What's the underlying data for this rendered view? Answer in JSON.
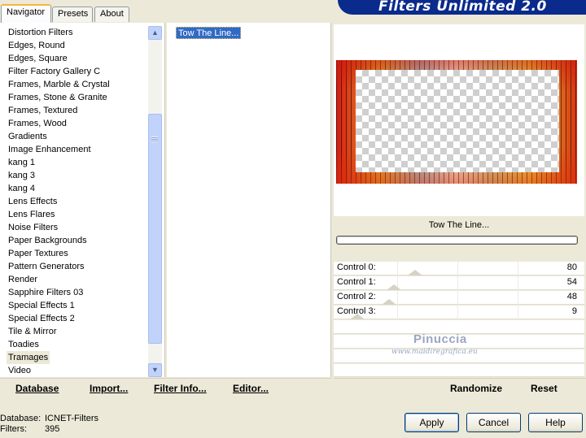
{
  "tabs": [
    {
      "label": "Navigator",
      "active": true
    },
    {
      "label": "Presets",
      "active": false
    },
    {
      "label": "About",
      "active": false
    }
  ],
  "banner_title": "Filters Unlimited 2.0",
  "categories": [
    "Distortion Filters",
    "Edges, Round",
    "Edges, Square",
    "Filter Factory Gallery C",
    "Frames, Marble & Crystal",
    "Frames, Stone & Granite",
    "Frames, Textured",
    "Frames, Wood",
    "Gradients",
    "Image Enhancement",
    "kang 1",
    "kang 3",
    "kang 4",
    "Lens Effects",
    "Lens Flares",
    "Noise Filters",
    "Paper Backgrounds",
    "Paper Textures",
    "Pattern Generators",
    "Render",
    "Sapphire Filters 03",
    "Special Effects 1",
    "Special Effects 2",
    "Tile & Mirror",
    "Toadies",
    "Tramages",
    "Video"
  ],
  "selected_category": "Tramages",
  "filters": [
    "Tow The Line..."
  ],
  "preview": {
    "filter_name": "Tow The Line..."
  },
  "controls": [
    {
      "label": "Control 0:",
      "value": "80",
      "level": 0.31
    },
    {
      "label": "Control 1:",
      "value": "54",
      "level": 0.21
    },
    {
      "label": "Control 2:",
      "value": "48",
      "level": 0.19
    },
    {
      "label": "Control 3:",
      "value": "9",
      "level": 0.04
    }
  ],
  "watermark": {
    "name": "Pinuccia",
    "url": "www.maidiregrafica.eu"
  },
  "left_toolbar": {
    "database": "Database",
    "import": "Import...",
    "filter_info": "Filter Info...",
    "editor": "Editor..."
  },
  "right_toolbar": {
    "randomize": "Randomize",
    "reset": "Reset"
  },
  "status": {
    "database_label": "Database:",
    "database_value": "ICNET-Filters",
    "filters_label": "Filters:",
    "filters_value": "395"
  },
  "buttons": {
    "apply": "Apply",
    "cancel": "Cancel",
    "help": "Help"
  },
  "colors": {
    "selection": "#316ac5",
    "banner": "#0a2a8c",
    "face": "#ece9d8"
  }
}
